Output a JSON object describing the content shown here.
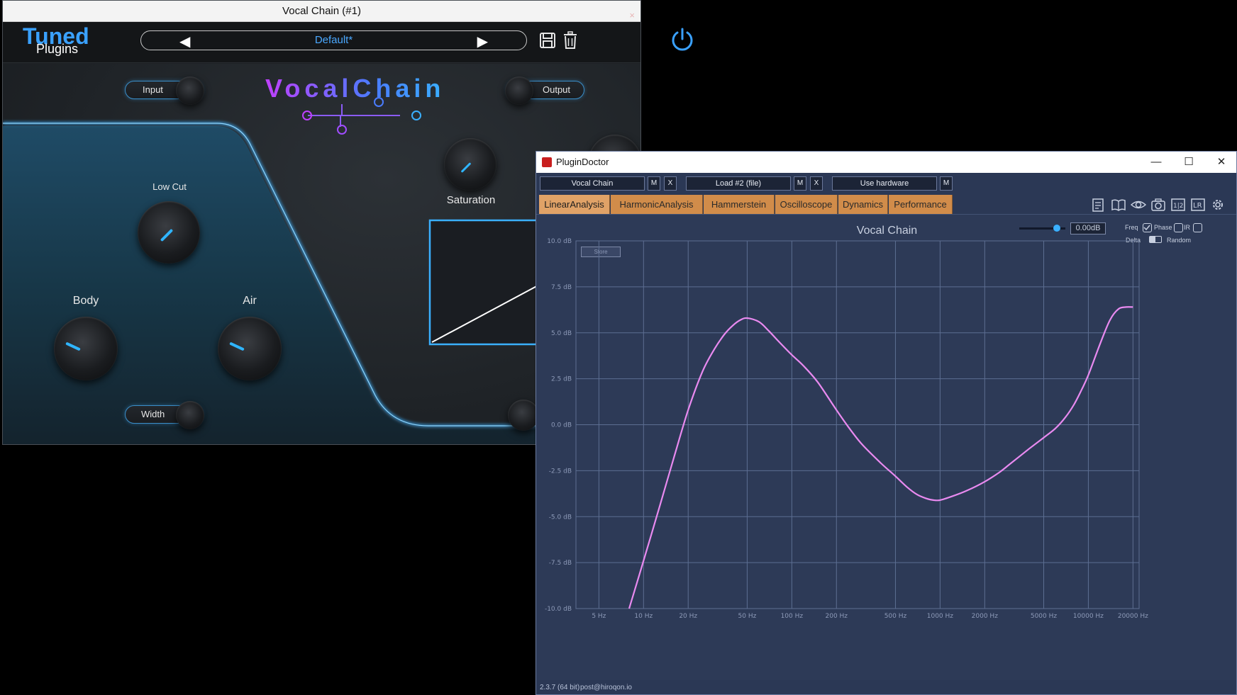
{
  "vocal_chain": {
    "window_title": "Vocal Chain (#1)",
    "close_glyph": "×",
    "logo_tuned": "Tuned",
    "logo_plugins": "Plugins",
    "preset_name": "Default*",
    "prev_glyph": "◀",
    "next_glyph": "▶",
    "brand_title": "VocalChain",
    "input_label": "Input",
    "output_label": "Output",
    "low_cut_label": "Low Cut",
    "saturation_label": "Saturation",
    "body_label": "Body",
    "air_label": "Air",
    "width_label": "Width",
    "accent_color": "#3aa1ff",
    "icons": [
      "save-icon",
      "trash-icon",
      "power-icon"
    ]
  },
  "plugin_doctor": {
    "window_title": "PluginDoctor",
    "minimize_glyph": "—",
    "maximize_glyph": "☐",
    "close_glyph": "✕",
    "slot1": "Vocal Chain",
    "slot2": "Load #2 (file)",
    "slot3": "Use hardware",
    "m_label": "M",
    "x_label": "X",
    "tabs": [
      "LinearAnalysis",
      "HarmonicAnalysis",
      "Hammerstein",
      "Oscilloscope",
      "Dynamics",
      "Performance"
    ],
    "active_tab": "LinearAnalysis",
    "tab_color": "#d18c4a",
    "gain_value": "0.00dB",
    "freq_label": "Freq",
    "phase_label": "Phase",
    "ir_label": "IR",
    "delta_label": "Delta",
    "random_label": "Random",
    "store_label": "Store",
    "version": "2.3.7 (64 bit)",
    "email": "post@hiroqon.io",
    "toolbar_icons": [
      "notes-icon",
      "book-icon",
      "eye-icon",
      "camera-icon",
      "split-icon",
      "lr-icon",
      "gear-icon"
    ]
  },
  "chart_data": {
    "type": "line",
    "title": "Vocal Chain",
    "xscale": "log",
    "xlim": [
      3.5,
      22000
    ],
    "ylim": [
      -10,
      10
    ],
    "x_ticks": [
      5,
      10,
      20,
      50,
      100,
      200,
      500,
      1000,
      2000,
      5000,
      10000,
      20000
    ],
    "x_tick_labels": [
      "5 Hz",
      "10 Hz",
      "20 Hz",
      "50 Hz",
      "100 Hz",
      "200 Hz",
      "500 Hz",
      "1000 Hz",
      "2000 Hz",
      "5000 Hz",
      "10000 Hz",
      "20000 Hz"
    ],
    "y_ticks": [
      10,
      7.5,
      5,
      2.5,
      0,
      -2.5,
      -5,
      -7.5,
      -10
    ],
    "y_tick_labels": [
      "10.0 dB",
      "7.5 dB",
      "5.0 dB",
      "2.5 dB",
      "0.0 dB",
      "-2.5 dB",
      "-5.0 dB",
      "-7.5 dB",
      "-10.0 dB"
    ],
    "grid": true,
    "line_color": "#e98af0",
    "x": [
      8,
      10,
      13,
      16,
      20,
      25,
      30,
      35,
      40,
      45,
      50,
      60,
      70,
      80,
      100,
      120,
      150,
      200,
      250,
      300,
      400,
      500,
      600,
      700,
      800,
      900,
      1000,
      1200,
      1500,
      2000,
      2500,
      3000,
      4000,
      5000,
      6000,
      7000,
      8000,
      9000,
      10000,
      12000,
      14000,
      16000,
      18000,
      20000
    ],
    "y": [
      -10.0,
      -7.4,
      -4.3,
      -1.8,
      0.8,
      2.9,
      4.1,
      4.9,
      5.4,
      5.7,
      5.8,
      5.6,
      5.1,
      4.6,
      3.8,
      3.2,
      2.3,
      0.8,
      -0.3,
      -1.1,
      -2.1,
      -2.8,
      -3.4,
      -3.8,
      -4.0,
      -4.1,
      -4.1,
      -3.9,
      -3.6,
      -3.1,
      -2.6,
      -2.1,
      -1.3,
      -0.7,
      -0.2,
      0.4,
      1.1,
      1.9,
      2.7,
      4.4,
      5.7,
      6.3,
      6.4,
      6.4
    ]
  }
}
